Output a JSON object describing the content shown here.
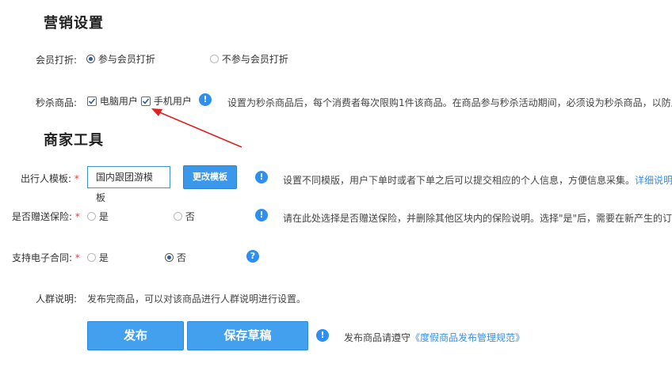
{
  "marketing": {
    "title": "营销设置",
    "member_discount": {
      "label": "会员打折:",
      "option_join": "参与会员打折",
      "option_not_join": "不参与会员打折"
    },
    "flash_sale": {
      "label": "秒杀商品:",
      "option_pc": "电脑用户",
      "option_mobile": "手机用户",
      "note": "设置为秒杀商品后，每个消费者每次限购1件该商品。在商品参与秒杀活动期间，必须设为秒杀商品，以防止作作"
    }
  },
  "merchant_tools": {
    "title": "商家工具",
    "traveler_template": {
      "label": "出行人模板:",
      "required_mark": "*",
      "value": "国内跟团游模板",
      "change_button": "更改模板",
      "note": "设置不同模版，用户下单时或者下单之后可以提交相应的个人信息，方便信息采集。",
      "link": "详细说明点击"
    },
    "insurance": {
      "label": "是否赠送保险:",
      "required_mark": "*",
      "option_yes": "是",
      "option_no": "否",
      "note": "请在此处选择是否赠送保险，并删除其他区块内的保险说明。选择\"是\"后，需要在新产生的订单上"
    },
    "e_contract": {
      "label": "支持电子合同:",
      "required_mark": "*",
      "option_yes": "是",
      "option_no": "否",
      "help_glyph": "?"
    },
    "audience": {
      "label": "人群说明:",
      "text": "发布完商品，可以对该商品进行人群说明进行设置。"
    }
  },
  "footer": {
    "publish_button": "发布",
    "save_draft_button": "保存草稿",
    "notice_prefix": "发布商品请遵守",
    "notice_link": "《度假商品发布管理规范》"
  },
  "icons": {
    "info_glyph": "!"
  },
  "colors": {
    "primary": "#3a97ea",
    "info_icon": "#2f8ff0",
    "link": "#3a8ee6",
    "required": "#e4393c",
    "annotation_arrow": "#e02020"
  }
}
